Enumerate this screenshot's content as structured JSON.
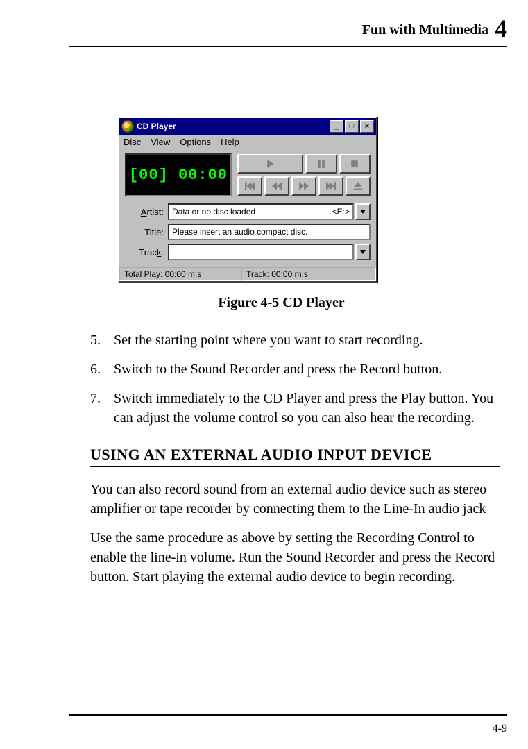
{
  "header": {
    "title": "Fun with Multimedia",
    "chapter_num": "4"
  },
  "figure": {
    "caption": "Figure 4-5    CD Player"
  },
  "cdplayer": {
    "title": "CD Player",
    "menu": {
      "disc": "Disc",
      "view": "View",
      "options": "Options",
      "help": "Help"
    },
    "display": "[00] 00:00",
    "artist_label": "Artist:",
    "artist_value": "Data or no disc loaded",
    "artist_drive": "<E:>",
    "title_label": "Title:",
    "title_value": "Please insert an audio compact disc.",
    "track_label": "Track:",
    "track_value": "",
    "status_left": "Total Play: 00:00 m:s",
    "status_right": "Track: 00:00 m:s"
  },
  "steps": [
    {
      "n": "5.",
      "text": "Set the starting point where you want to start recording."
    },
    {
      "n": "6.",
      "text": "Switch to the Sound Recorder and press the Record button."
    },
    {
      "n": "7.",
      "text": "Switch immediately to the CD Player and press the Play button. You can adjust the volume control so you can also hear the recording."
    }
  ],
  "section_heading": "USING AN EXTERNAL AUDIO INPUT DEVICE",
  "paragraphs": [
    "You can also record sound from an external audio device such as stereo amplifier or tape recorder by connecting them to the Line-In audio jack",
    "Use the same procedure as above by setting the Recording Control to enable the line-in volume. Run the Sound Recorder and press the Record button. Start playing the external audio device to begin recording."
  ],
  "footer_page": "4-9"
}
